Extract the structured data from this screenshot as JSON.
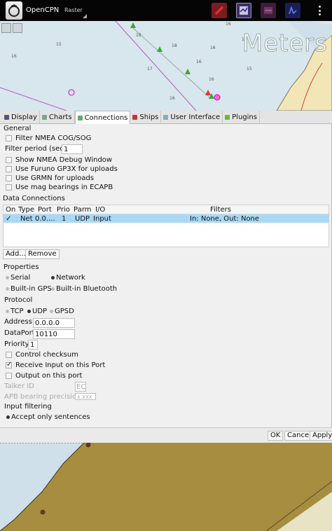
{
  "app": {
    "title": "OpenCPN",
    "mode": "Raster"
  },
  "chart_overlay": {
    "units": "Meters"
  },
  "tabs": [
    {
      "label": "Display",
      "icon": "display-icon",
      "active": false
    },
    {
      "label": "Charts",
      "icon": "charts-icon",
      "active": false
    },
    {
      "label": "Connections",
      "icon": "connections-icon",
      "active": true
    },
    {
      "label": "Ships",
      "icon": "ships-icon",
      "active": false
    },
    {
      "label": "User Interface",
      "icon": "user-interface-icon",
      "active": false
    },
    {
      "label": "Plugins",
      "icon": "plugins-icon",
      "active": false
    }
  ],
  "general": {
    "heading": "General",
    "filter_cog_sog": "Filter NMEA COG/SOG",
    "filter_period_label": "Filter period (sec)",
    "filter_period_value": "1",
    "show_debug": "Show NMEA Debug Window",
    "furuno": "Use Furuno GP3X for uploads",
    "grmn": "Use GRMN for uploads",
    "mag_bearings": "Use mag bearings in ECAPB"
  },
  "data_connections": {
    "heading": "Data Connections",
    "columns": [
      "On",
      "Type",
      "Port",
      "Prio",
      "Parm",
      "I/O",
      "Filters"
    ],
    "rows": [
      {
        "on": "✓",
        "type": "Net",
        "port": "0.0....",
        "prio": "1",
        "parm": "UDP",
        "io": "Input",
        "filters": "In: None, Out: None"
      }
    ],
    "add_label": "Add...",
    "remove_label": "Remove"
  },
  "properties": {
    "heading": "Properties",
    "serial": "Serial",
    "network": "Network",
    "builtin_gps": "Built-in GPS",
    "builtin_bt": "Built-in Bluetooth",
    "protocol_heading": "Protocol",
    "tcp": "TCP",
    "udp": "UDP",
    "gpsd": "GPSD",
    "address_label": "Address",
    "address_value": "0.0.0.0",
    "dataport_label": "DataPort",
    "dataport_value": "10110",
    "priority_label": "Priority",
    "priority_value": "1",
    "control_checksum": "Control checksum",
    "receive_input": "Receive Input on this Port",
    "output_port": "Output on this port",
    "talker_id_label": "Talker ID",
    "talker_id_value": "EC",
    "apb_label": "APB bearing precision",
    "apb_value": "x.xxx",
    "input_filtering_heading": "Input filtering",
    "accept_only": "Accept only sentences"
  },
  "buttons": {
    "ok": "OK",
    "cancel": "Cancel",
    "apply": "Apply"
  },
  "colors": {
    "selection": "#a9d8f4",
    "water": "#d8e6ee",
    "land": "#a78d40"
  }
}
